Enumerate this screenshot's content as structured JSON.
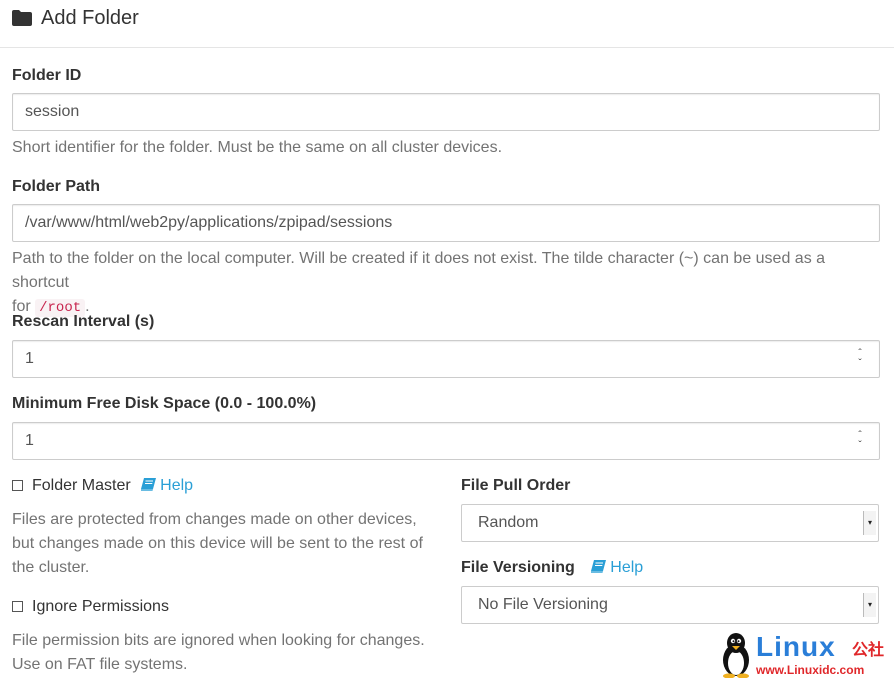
{
  "header": {
    "title": "Add Folder",
    "icon": "folder-icon"
  },
  "folder_id": {
    "label": "Folder ID",
    "value": "session",
    "help": "Short identifier for the folder. Must be the same on all cluster devices."
  },
  "folder_path": {
    "label": "Folder Path",
    "value": "/var/www/html/web2py/applications/zpipad/sessions",
    "help_line1": "Path to the folder on the local computer. Will be created if it does not exist. The tilde character (~) can be used as a shortcut",
    "help_line2_prefix": "for",
    "help_code": "/root",
    "help_line2_suffix": "."
  },
  "rescan_interval": {
    "label": "Rescan Interval (s)",
    "value": "1"
  },
  "min_disk": {
    "label": "Minimum Free Disk Space (0.0 - 100.0%)",
    "value": "1"
  },
  "folder_master": {
    "label": "Folder Master",
    "help_link": "Help",
    "checked": false,
    "help_line1": "Files are protected from changes made on other devices,",
    "help_line2": "but changes made on this device will be sent to the rest of",
    "help_line3": "the cluster."
  },
  "ignore_permissions": {
    "label": "Ignore Permissions",
    "checked": false,
    "help_line1": "File permission bits are ignored when looking for changes.",
    "help_line2": "Use on FAT file systems."
  },
  "file_pull_order": {
    "label": "File Pull Order",
    "selected": "Random"
  },
  "file_versioning": {
    "label": "File Versioning",
    "help_link": "Help",
    "selected": "No File Versioning"
  },
  "watermark": {
    "brand": "Linux",
    "brand_cn": "公社",
    "url": "www.Linuxidc.com"
  },
  "colors": {
    "link": "#2a9fd6",
    "code_text": "#c7254e",
    "code_bg": "#f9f2f4",
    "help_text": "#737373"
  }
}
